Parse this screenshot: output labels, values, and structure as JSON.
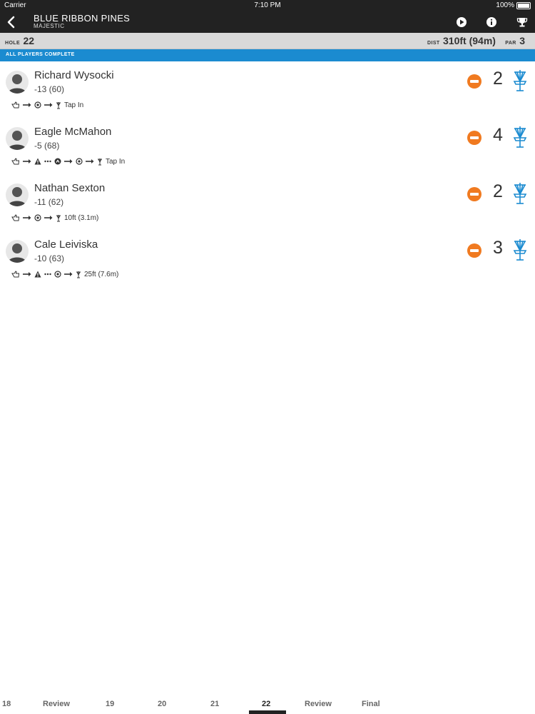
{
  "status": {
    "carrier": "Carrier",
    "time": "7:10 PM",
    "battery": "100%"
  },
  "header": {
    "course": "BLUE RIBBON PINES",
    "layout": "MAJESTIC"
  },
  "hole_bar": {
    "hole_label": "HOLE",
    "hole_number": "22",
    "dist_label": "DIST",
    "distance": "310ft (94m)",
    "par_label": "PAR",
    "par": "3"
  },
  "banner": "ALL PLAYERS COMPLETE",
  "players": [
    {
      "name": "Richard Wysocki",
      "total": "-13 (60)",
      "score": "2",
      "shot_text": "Tap In"
    },
    {
      "name": "Eagle McMahon",
      "total": "-5 (68)",
      "score": "4",
      "shot_text": "Tap In"
    },
    {
      "name": "Nathan Sexton",
      "total": "-11 (62)",
      "score": "2",
      "shot_text": "10ft (3.1m)"
    },
    {
      "name": "Cale Leiviska",
      "total": "-10 (63)",
      "score": "3",
      "shot_text": "25ft (7.6m)"
    }
  ],
  "tabs": [
    "18",
    "Review",
    "19",
    "20",
    "21",
    "22",
    "Review",
    "Final"
  ],
  "active_tab_index": 5,
  "colors": {
    "accent": "#1b8bd0",
    "bogey_badge": "#f07a20",
    "header_bg": "#222222",
    "basket": "#1b8bd0"
  }
}
